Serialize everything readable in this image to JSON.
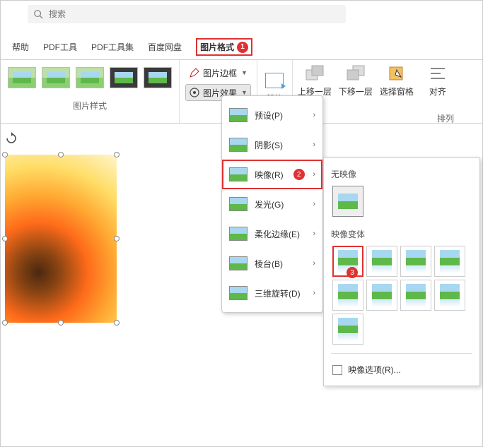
{
  "search": {
    "placeholder": "搜索"
  },
  "tabs": {
    "help": "帮助",
    "pdf_tools": "PDF工具",
    "pdf_toolset": "PDF工具集",
    "baidu_disk": "百度网盘",
    "pic_format": "图片格式"
  },
  "badges": {
    "one": "1",
    "two": "2",
    "three": "3"
  },
  "ribbon": {
    "styles_label": "图片样式",
    "border_label": "图片边框",
    "effects_label": "图片效果",
    "replace_label": "替换",
    "bring_forward": "上移一层",
    "send_backward": "下移一层",
    "selection_pane": "选择窗格",
    "align": "对齐",
    "arrange_label": "排列"
  },
  "dropdown": {
    "preset": "预设(P)",
    "shadow": "阴影(S)",
    "reflection": "映像(R)",
    "glow": "发光(G)",
    "soft_edges": "柔化边缘(E)",
    "bevel": "棱台(B)",
    "rotation_3d": "三维旋转(D)"
  },
  "flyout": {
    "no_reflection": "无映像",
    "variants": "映像变体",
    "options": "映像选项(R)..."
  }
}
